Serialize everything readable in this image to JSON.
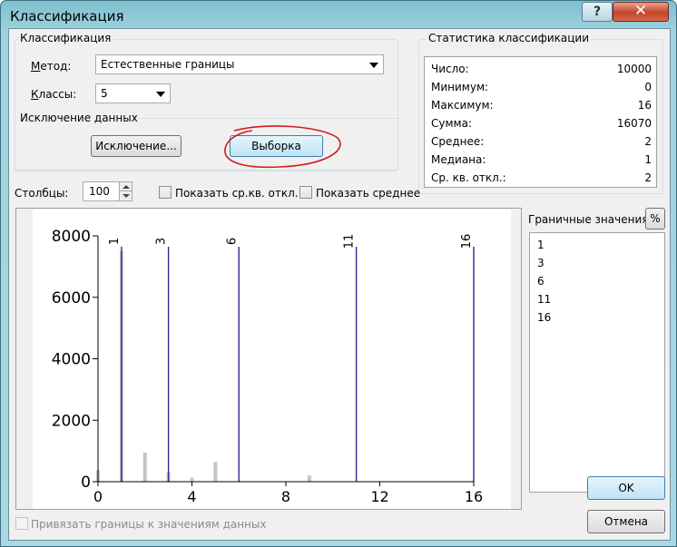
{
  "window": {
    "title": "Классификация",
    "help_label": "?",
    "close_label": "✕"
  },
  "classification_group": {
    "title": "Классификация",
    "method_label": "Метод:",
    "method_value": "Естественные границы",
    "classes_label": "Классы:",
    "classes_value": "5"
  },
  "exclusion_group": {
    "title": "Исключение данных",
    "exclusion_button": "Исключение...",
    "sample_button": "Выборка"
  },
  "stats_group": {
    "title": "Статистика классификации",
    "rows": [
      {
        "label": "Число:",
        "value": "10000"
      },
      {
        "label": "Минимум:",
        "value": "0"
      },
      {
        "label": "Максимум:",
        "value": "16"
      },
      {
        "label": "Сумма:",
        "value": "16070"
      },
      {
        "label": "Среднее:",
        "value": "2"
      },
      {
        "label": "Медиана:",
        "value": "1"
      },
      {
        "label": "Ср. кв. откл.:",
        "value": "2"
      }
    ]
  },
  "columns": {
    "label": "Столбцы:",
    "value": "100"
  },
  "show_std": {
    "label": "Показать ср.кв. откл.",
    "checked": false
  },
  "show_mean": {
    "label": "Показать среднее",
    "checked": false
  },
  "boundaries": {
    "title": "Граничные значения",
    "percent_button": "%",
    "values": [
      "1",
      "3",
      "6",
      "11",
      "16"
    ]
  },
  "snap_checkbox": {
    "label": "Привязать границы к значениям данных",
    "checked": false,
    "enabled": false
  },
  "ok_button": "OK",
  "cancel_button": "Отмена",
  "chart_data": {
    "type": "bar",
    "xlim": [
      0,
      16
    ],
    "ylim": [
      0,
      8000
    ],
    "x_ticks": [
      "0",
      "4",
      "8",
      "12",
      "16"
    ],
    "y_ticks": [
      "0",
      "2000",
      "4000",
      "6000",
      "8000"
    ],
    "bars": [
      {
        "x": 0,
        "value": 380
      },
      {
        "x": 1,
        "value": 7500
      },
      {
        "x": 2,
        "value": 950
      },
      {
        "x": 3,
        "value": 300
      },
      {
        "x": 4,
        "value": 130
      },
      {
        "x": 5,
        "value": 640
      },
      {
        "x": 9,
        "value": 200
      }
    ],
    "break_lines": [
      {
        "x": 1,
        "label": "1"
      },
      {
        "x": 3,
        "label": "3"
      },
      {
        "x": 6,
        "label": "6"
      },
      {
        "x": 11,
        "label": "11"
      },
      {
        "x": 16,
        "label": "16"
      }
    ],
    "colors": {
      "bar": "#c4c4c4",
      "break_line": "#2b2b9a",
      "background": "#ffffff"
    }
  }
}
